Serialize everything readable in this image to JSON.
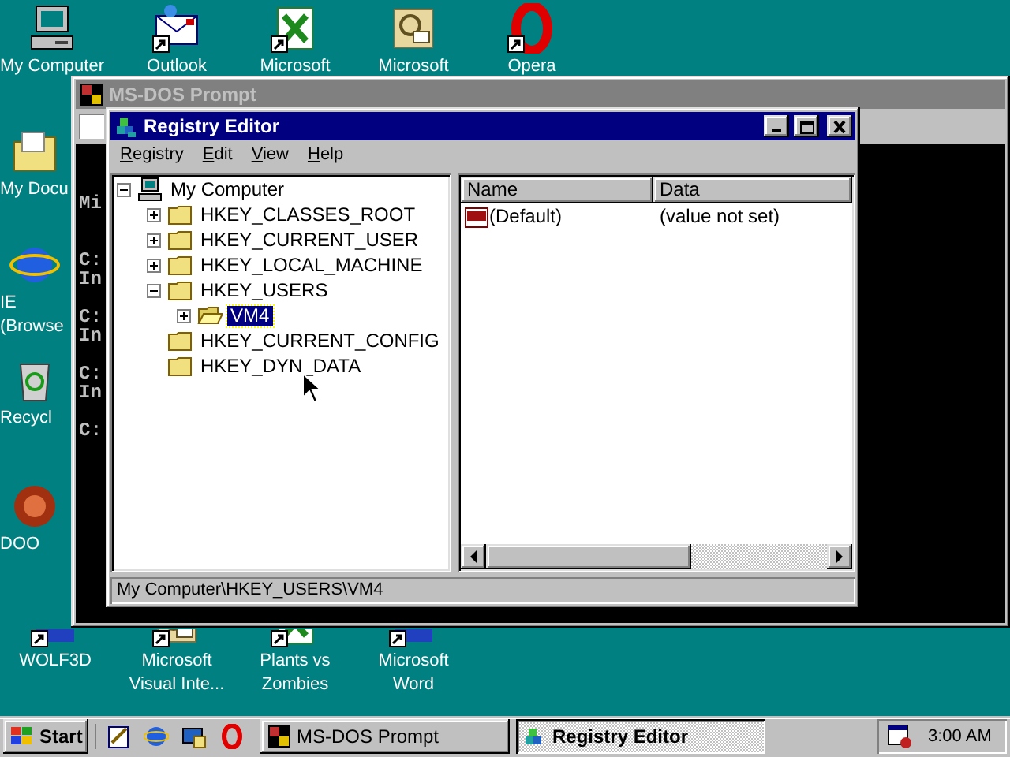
{
  "desktop_icons": [
    {
      "kind": "computer",
      "lines": [
        "My Computer"
      ],
      "shortcut": false
    },
    {
      "kind": "mail",
      "lines": [
        "Outlook"
      ],
      "shortcut": true
    },
    {
      "kind": "sheet",
      "lines": [
        "Microsoft"
      ],
      "shortcut": true
    },
    {
      "kind": "doc",
      "lines": [
        "Microsoft"
      ],
      "shortcut": false
    },
    {
      "kind": "ring",
      "lines": [
        "Opera"
      ],
      "shortcut": true
    },
    {
      "kind": "folder",
      "lines": [
        "My Docu"
      ],
      "shortcut": false
    },
    {
      "kind": "globe",
      "lines": [
        "IE",
        "(Browse"
      ],
      "shortcut": false
    },
    {
      "kind": "bin",
      "lines": [
        "Recycl"
      ],
      "shortcut": false
    },
    {
      "kind": "disc",
      "lines": [
        "DOO"
      ],
      "shortcut": false
    },
    {
      "kind": "blue",
      "lines": [
        "WOLF3D"
      ],
      "shortcut": true
    },
    {
      "kind": "doc",
      "lines": [
        "Microsoft",
        "Visual Inte..."
      ],
      "shortcut": true
    },
    {
      "kind": "sheet",
      "lines": [
        "Plants vs",
        "Zombies"
      ],
      "shortcut": true
    },
    {
      "kind": "blue",
      "lines": [
        "Microsoft",
        "Word"
      ],
      "shortcut": true
    }
  ],
  "dos_window": {
    "title": "MS-DOS Prompt",
    "active": false,
    "console_lines": [
      "Mi",
      "C:",
      "In",
      "C:",
      "In",
      "C:",
      "In",
      "C:"
    ]
  },
  "registry_editor": {
    "title": "Registry Editor",
    "active": true,
    "menu": [
      "Registry",
      "Edit",
      "View",
      "Help"
    ],
    "tree": [
      {
        "label": "My Computer",
        "kind": "computer",
        "expanded": true,
        "selected": false,
        "children": [
          {
            "label": "HKEY_CLASSES_ROOT",
            "kind": "key",
            "expanded": false,
            "selected": false
          },
          {
            "label": "HKEY_CURRENT_USER",
            "kind": "key",
            "expanded": false,
            "selected": false
          },
          {
            "label": "HKEY_LOCAL_MACHINE",
            "kind": "key",
            "expanded": false,
            "selected": false
          },
          {
            "label": "HKEY_USERS",
            "kind": "key",
            "expanded": true,
            "selected": false,
            "children": [
              {
                "label": "VM4",
                "kind": "key",
                "expanded": false,
                "selected": true
              }
            ]
          },
          {
            "label": "HKEY_CURRENT_CONFIG",
            "kind": "key",
            "selected": false
          },
          {
            "label": "HKEY_DYN_DATA",
            "kind": "key",
            "selected": false
          }
        ]
      }
    ],
    "columns": [
      "Name",
      "Data"
    ],
    "values": [
      {
        "name": "(Default)",
        "data": "(value not set)"
      }
    ],
    "status_bar": "My Computer\\HKEY_USERS\\VM4"
  },
  "taskbar": {
    "start": "Start",
    "tasks": [
      {
        "label": "MS-DOS Prompt",
        "selected": false
      },
      {
        "label": "Registry Editor",
        "selected": true
      }
    ],
    "clock": "3:00 AM"
  }
}
